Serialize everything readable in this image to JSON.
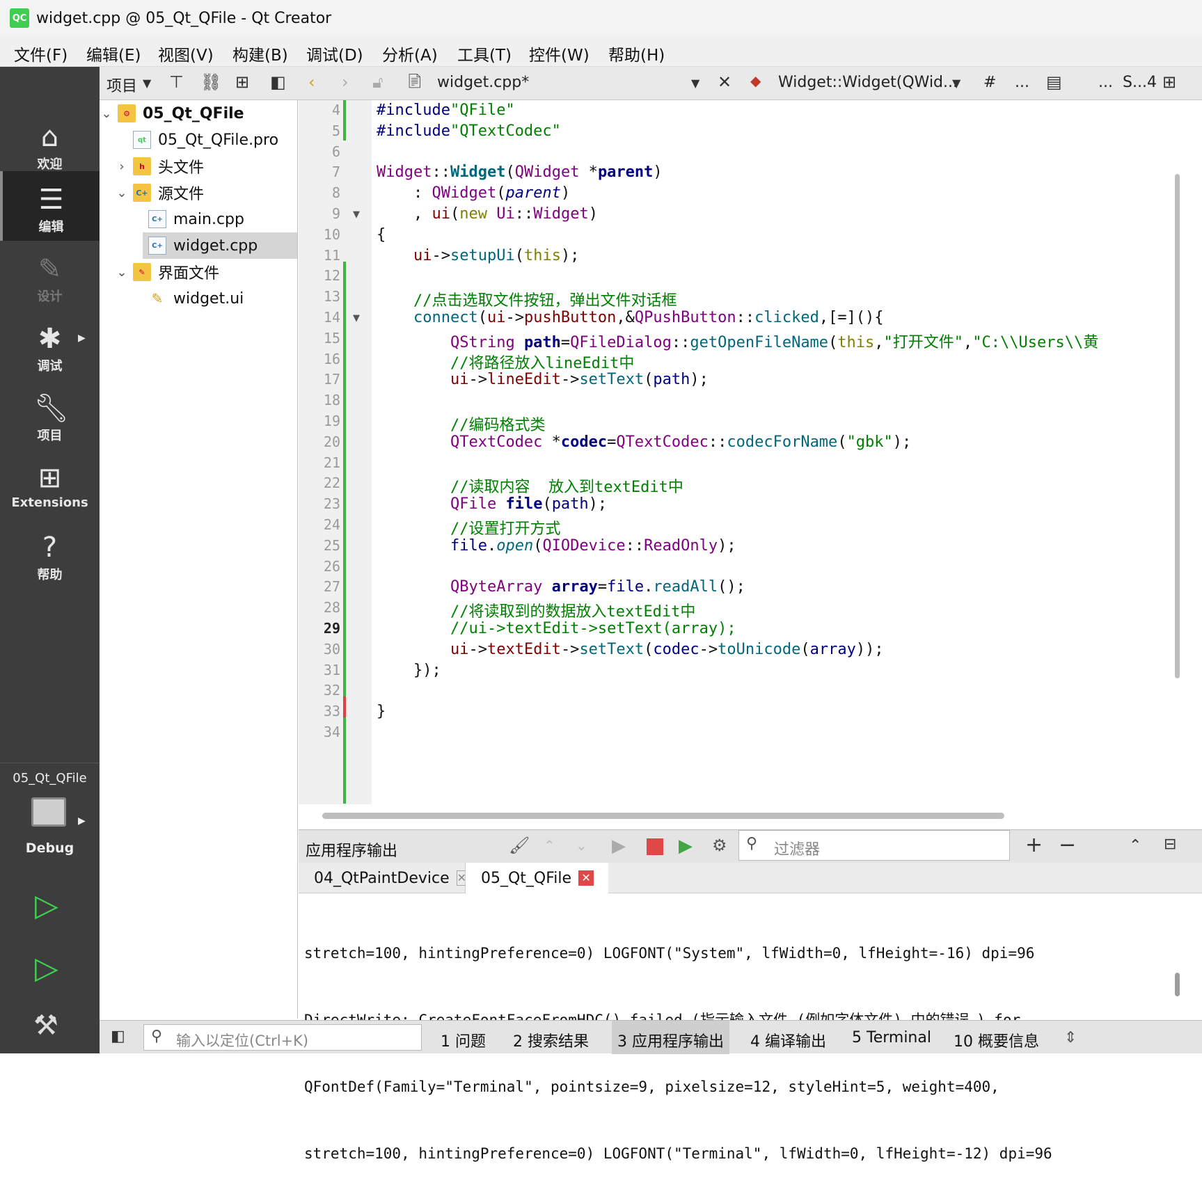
{
  "window": {
    "title": "widget.cpp @ 05_Qt_QFile - Qt Creator",
    "logo": "QC"
  },
  "menu": [
    "文件(F)",
    "编辑(E)",
    "视图(V)",
    "构建(B)",
    "调试(D)",
    "分析(A)",
    "工具(T)",
    "控件(W)",
    "帮助(H)"
  ],
  "toolbar": {
    "project_label": "项目",
    "file_name": "widget.cpp*",
    "function_name": "Widget::Widget(QWid...",
    "hash": "#",
    "dots": "...",
    "dots2": "...",
    "split_label": "S...4"
  },
  "modes": [
    {
      "name": "home",
      "label": "欢迎",
      "icon": "home-icon"
    },
    {
      "name": "edit",
      "label": "编辑",
      "icon": "edit-lines-icon"
    },
    {
      "name": "design",
      "label": "设计",
      "icon": "pen-icon"
    },
    {
      "name": "debug",
      "label": "调试",
      "icon": "bug-icon"
    },
    {
      "name": "projects",
      "label": "项目",
      "icon": "wrench-icon"
    },
    {
      "name": "extensions",
      "label": "Extensions",
      "icon": "extensions-icon"
    },
    {
      "name": "help",
      "label": "帮助",
      "icon": "help-icon"
    }
  ],
  "kit": {
    "project": "05_Qt_QFile",
    "config": "Debug"
  },
  "tree": {
    "root": "05_Qt_QFile",
    "pro": "05_Qt_QFile.pro",
    "headers": "头文件",
    "sources": "源文件",
    "main": "main.cpp",
    "widget": "widget.cpp",
    "forms": "界面文件",
    "ui": "widget.ui"
  },
  "code": {
    "line_start": 4,
    "line_end": 34,
    "current_line": 29,
    "fold_lines": [
      9,
      14
    ]
  },
  "output": {
    "title": "应用程序输出",
    "filter_placeholder": "过滤器",
    "tab1": "04_QtPaintDevice",
    "tab2": "05_Qt_QFile",
    "lines": [
      "stretch=100, hintingPreference=0) LOGFONT(\"System\", lfWidth=0, lfHeight=-16) dpi=96",
      "DirectWrite: CreateFontFaceFromHDC() failed (指示输入文件 (例如字体文件) 中的错误。) for",
      "QFontDef(Family=\"Terminal\", pointsize=9, pixelsize=12, styleHint=5, weight=400,",
      "stretch=100, hintingPreference=0) LOGFONT(\"Terminal\", lfWidth=0, lfHeight=-12) dpi=96"
    ]
  },
  "status": {
    "locator_placeholder": "输入以定位(Ctrl+K)",
    "tabs": [
      "1  问题",
      "2  搜索结果",
      "3  应用程序输出",
      "4  编译输出",
      "5  Terminal",
      "10  概要信息"
    ]
  },
  "colors": {
    "accent_green": "#41cd52",
    "mode_bar": "#3d3d3d",
    "comment": "#008000",
    "type": "#800080",
    "function": "#00677c"
  }
}
